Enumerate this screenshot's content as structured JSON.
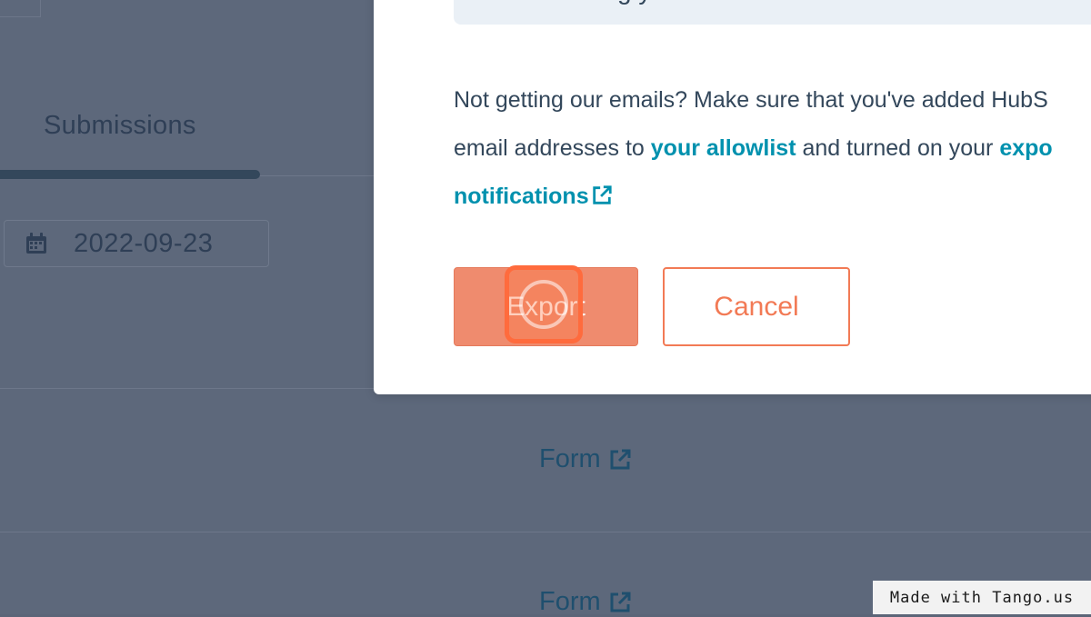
{
  "background": {
    "tab_label": "Submissions",
    "date_value": "2022-09-23",
    "form_link_1": "Form",
    "form_link_2": "Form"
  },
  "modal": {
    "callout_partial_text": "g   y",
    "message_line1": "Not getting our emails? Make sure that you've added HubS",
    "message_line2_prefix": "email addresses to ",
    "allowlist_link": "your allowlist",
    "message_line2_middle": " and turned on your ",
    "export_link_start": "expo",
    "notifications_link": "notifications",
    "export_button_label": "Export",
    "cancel_button_label": "Cancel"
  },
  "watermark": {
    "text": "Made with Tango.us"
  },
  "colors": {
    "overlay": "#5d687b",
    "accent_orange": "#f27a55",
    "link_teal": "#0091ae",
    "text_dark": "#33475b"
  },
  "icons": {
    "calendar": "calendar-icon",
    "external_link": "external-link-icon"
  }
}
